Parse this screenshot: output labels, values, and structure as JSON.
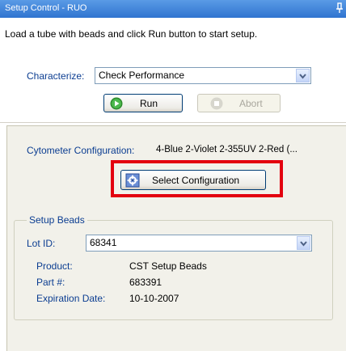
{
  "window": {
    "title": "Setup Control - RUO"
  },
  "instructions": "Load a tube with beads and click Run button to start setup.",
  "characterize": {
    "label": "Characterize:",
    "value": "Check Performance"
  },
  "buttons": {
    "run": "Run",
    "abort": "Abort",
    "select_configuration": "Select Configuration"
  },
  "cytometer": {
    "label": "Cytometer Configuration:",
    "value": "4-Blue  2-Violet  2-355UV  2-Red (..."
  },
  "setup_beads": {
    "group_label": "Setup Beads",
    "lot_label": "Lot ID:",
    "lot_value": "68341",
    "product_label": "Product:",
    "product_value": "CST Setup Beads",
    "part_label": "Part #:",
    "part_value": "683391",
    "expiration_label": "Expiration Date:",
    "expiration_value": "10-10-2007"
  },
  "colors": {
    "title_bar": "#2f74d0",
    "highlight_box": "#e3000f",
    "label_text": "#0b3d91"
  }
}
